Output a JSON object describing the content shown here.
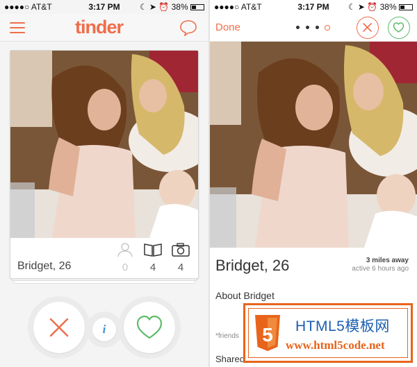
{
  "left_screen": {
    "status": {
      "carrier": "●●●●○ AT&T",
      "time": "3:17 PM",
      "battery": "38%"
    },
    "nav": {
      "logo": "tinder",
      "menu_icon": "hamburger-menu-icon",
      "chat_icon": "chat-bubble-icon"
    },
    "card": {
      "name": "Bridget, 26",
      "stats": [
        {
          "icon": "friends-icon",
          "value": "0"
        },
        {
          "icon": "book-icon",
          "value": "4"
        },
        {
          "icon": "camera-icon",
          "value": "4"
        }
      ]
    },
    "actions": {
      "dislike_icon": "x-icon",
      "info_label": "i",
      "like_icon": "heart-icon"
    }
  },
  "right_screen": {
    "status": {
      "carrier": "●●●●○ AT&T",
      "time": "3:17 PM",
      "battery": "38%"
    },
    "nav": {
      "done_label": "Done",
      "pager_dots": 4,
      "active_dot": 4
    },
    "profile": {
      "name": "Bridget, 26",
      "distance": "3 miles away",
      "active": "active 6 hours ago",
      "about_heading": "About Bridget",
      "friends_text": "*friends",
      "shared_heading": "Shared"
    }
  },
  "watermark": {
    "title": "HTML5模板网",
    "url": "www.html5code.net",
    "badge": "5"
  },
  "colors": {
    "accent": "#ef6e4a",
    "like_green": "#5dbb6a",
    "info_blue": "#3d8fd4",
    "watermark_orange": "#e8641b",
    "watermark_blue": "#1c5fb0"
  }
}
